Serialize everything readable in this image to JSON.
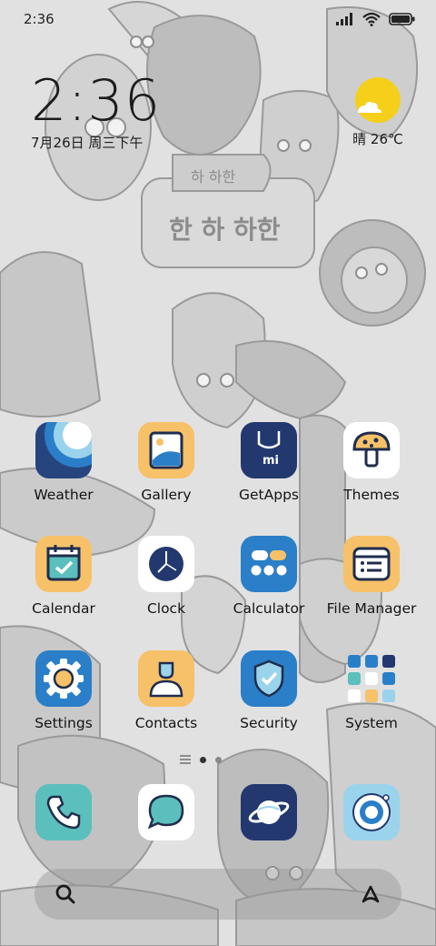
{
  "status_bar": {
    "time": "2:36",
    "icons": [
      "signal-icon",
      "wifi-icon",
      "battery-icon"
    ]
  },
  "lockclock": {
    "time": "2:36",
    "date": "7月26日 周三下午"
  },
  "weather": {
    "temp": "晴 26℃",
    "icon": "sunny-cloud-icon"
  },
  "wallpaper_text": {
    "small": "하 하한",
    "large": "한 하 하한"
  },
  "apps": [
    {
      "label": "Weather",
      "icon": "weather-icon",
      "bg": "#26457f"
    },
    {
      "label": "Gallery",
      "icon": "gallery-icon",
      "bg": "#f6c169"
    },
    {
      "label": "GetApps",
      "icon": "getapps-icon",
      "bg": "#23386f"
    },
    {
      "label": "Themes",
      "icon": "themes-icon",
      "bg": "#ffffff"
    },
    {
      "label": "Calendar",
      "icon": "calendar-icon",
      "bg": "#f6c169"
    },
    {
      "label": "Clock",
      "icon": "clock-icon",
      "bg": "#ffffff"
    },
    {
      "label": "Calculator",
      "icon": "calculator-icon",
      "bg": "#2a7fc8"
    },
    {
      "label": "File Manager",
      "icon": "file-manager-icon",
      "bg": "#f6c169"
    },
    {
      "label": "Settings",
      "icon": "settings-icon",
      "bg": "#2a7fc8"
    },
    {
      "label": "Contacts",
      "icon": "contacts-icon",
      "bg": "#f6c169"
    },
    {
      "label": "Security",
      "icon": "security-icon",
      "bg": "#2a7fc8"
    },
    {
      "label": "System",
      "icon": "system-folder-icon",
      "bg": "transparent"
    }
  ],
  "page_indicator": {
    "pages": 2,
    "current": 1
  },
  "dock": [
    {
      "icon": "phone-icon",
      "bg": "#5bbfbd"
    },
    {
      "icon": "messages-icon",
      "bg": "#ffffff"
    },
    {
      "icon": "browser-icon",
      "bg": "#23386f"
    },
    {
      "icon": "camera-icon",
      "bg": "#9ad3ec"
    }
  ],
  "searchbar": {
    "left_icon": "search-icon",
    "right_icon": "assistant-icon"
  }
}
